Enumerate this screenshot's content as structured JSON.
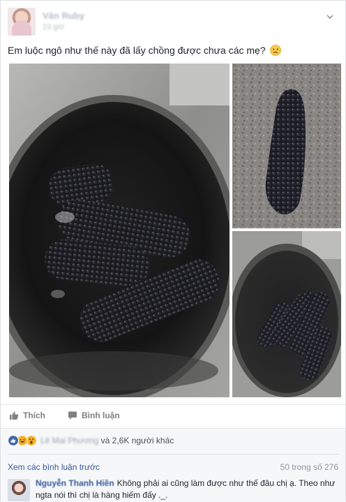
{
  "post": {
    "author": "Vân Ruby",
    "time": "23 giờ",
    "text": "Em luộc ngô như thế này đã lấy chồng được chưa các mẹ?"
  },
  "actions": {
    "like_label": "Thích",
    "comment_label": "Bình luận"
  },
  "reactions": {
    "names_blurred": "Lê Mai Phương",
    "others": "và 2,6K người khác"
  },
  "comments": {
    "view_previous": "Xem các bình luận trước",
    "count": "50 trong số 276",
    "items": [
      {
        "name": "Nguyễn Thanh Hiền",
        "text": "Không phải ai cũng làm được như thế đâu chị ạ. Theo như ngta nói thì chị là hàng hiếm đấy ._."
      }
    ]
  },
  "colors": {
    "link": "#365899",
    "like_blue": "#4267b2",
    "haha_yellow": "#f7b125",
    "muted": "#90949c"
  },
  "icons": [
    "caret-down-icon",
    "confused-emoji-icon",
    "like-icon",
    "comment-icon",
    "like-reaction-icon",
    "haha-reaction-icon",
    "wow-reaction-icon"
  ]
}
